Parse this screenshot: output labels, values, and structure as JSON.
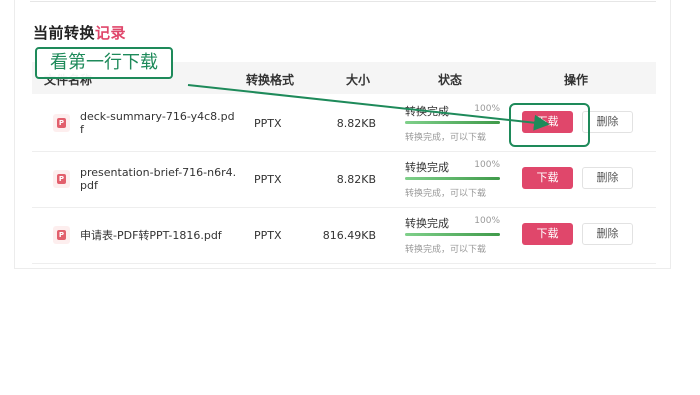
{
  "section_title": {
    "prefix": "当前转换",
    "highlight": "记录"
  },
  "columns": {
    "name": "文件名称",
    "format": "转换格式",
    "size": "大小",
    "status": "状态",
    "action": "操作"
  },
  "rows": [
    {
      "name_line1": "deck-summary-716-y4c8.pd",
      "name_line2": "f",
      "format": "PPTX",
      "size": "8.82KB",
      "status": "转换完成",
      "percent": "100%",
      "progress": 1.0,
      "note": "转换完成，可以下载",
      "download": "下载",
      "delete": "删除"
    },
    {
      "name_line1": "presentation-brief-716-n6r4.",
      "name_line2": "pdf",
      "format": "PPTX",
      "size": "8.82KB",
      "status": "转换完成",
      "percent": "100%",
      "progress": 1.0,
      "note": "转换完成，可以下载",
      "download": "下载",
      "delete": "删除"
    },
    {
      "name_line1": "申请表-PDF转PPT-1816.pdf",
      "name_line2": "",
      "format": "PPTX",
      "size": "816.49KB",
      "status": "转换完成",
      "percent": "100%",
      "progress": 1.0,
      "note": "转换完成，可以下载",
      "download": "下载",
      "delete": "删除"
    }
  ],
  "file_icon_glyph": "P",
  "annotation": {
    "text": "看第一行下载"
  },
  "colors": {
    "accent": "#e0476b",
    "annotation": "#1e8a5a",
    "progress": "#4caf50"
  }
}
